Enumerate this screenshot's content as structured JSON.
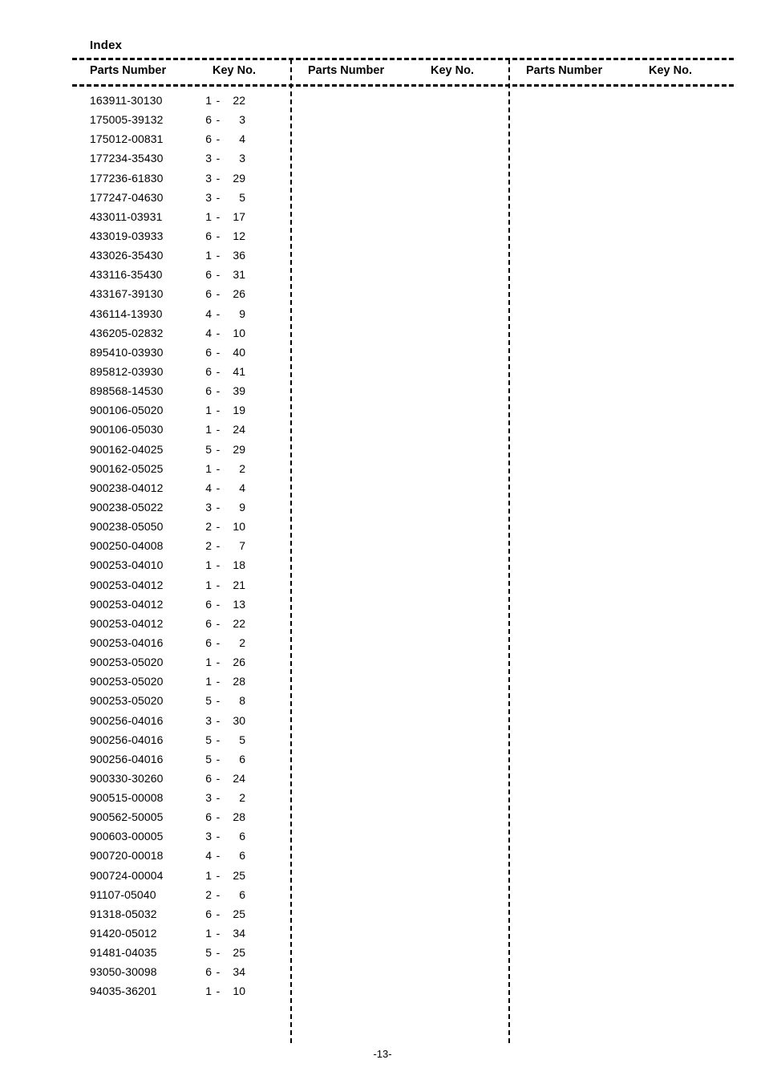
{
  "document": {
    "index_title": "Index",
    "page_number": "-13-"
  },
  "columns": [
    {
      "header_parts_number": "Parts Number",
      "header_key_no": "Key No.",
      "rows": [
        {
          "part": "163911-30130",
          "fig": "1",
          "dash": "-",
          "key": "22"
        },
        {
          "part": "175005-39132",
          "fig": "6",
          "dash": "-",
          "key": "3"
        },
        {
          "part": "175012-00831",
          "fig": "6",
          "dash": "-",
          "key": "4"
        },
        {
          "part": "177234-35430",
          "fig": "3",
          "dash": "-",
          "key": "3"
        },
        {
          "part": "177236-61830",
          "fig": "3",
          "dash": "-",
          "key": "29"
        },
        {
          "part": "177247-04630",
          "fig": "3",
          "dash": "-",
          "key": "5"
        },
        {
          "part": "433011-03931",
          "fig": "1",
          "dash": "-",
          "key": "17"
        },
        {
          "part": "433019-03933",
          "fig": "6",
          "dash": "-",
          "key": "12"
        },
        {
          "part": "433026-35430",
          "fig": "1",
          "dash": "-",
          "key": "36"
        },
        {
          "part": "433116-35430",
          "fig": "6",
          "dash": "-",
          "key": "31"
        },
        {
          "part": "433167-39130",
          "fig": "6",
          "dash": "-",
          "key": "26"
        },
        {
          "part": "436114-13930",
          "fig": "4",
          "dash": "-",
          "key": "9"
        },
        {
          "part": "436205-02832",
          "fig": "4",
          "dash": "-",
          "key": "10"
        },
        {
          "part": "895410-03930",
          "fig": "6",
          "dash": "-",
          "key": "40"
        },
        {
          "part": "895812-03930",
          "fig": "6",
          "dash": "-",
          "key": "41"
        },
        {
          "part": "898568-14530",
          "fig": "6",
          "dash": "-",
          "key": "39"
        },
        {
          "part": "900106-05020",
          "fig": "1",
          "dash": "-",
          "key": "19"
        },
        {
          "part": "900106-05030",
          "fig": "1",
          "dash": "-",
          "key": "24"
        },
        {
          "part": "900162-04025",
          "fig": "5",
          "dash": "-",
          "key": "29"
        },
        {
          "part": "900162-05025",
          "fig": "1",
          "dash": "-",
          "key": "2"
        },
        {
          "part": "900238-04012",
          "fig": "4",
          "dash": "-",
          "key": "4"
        },
        {
          "part": "900238-05022",
          "fig": "3",
          "dash": "-",
          "key": "9"
        },
        {
          "part": "900238-05050",
          "fig": "2",
          "dash": "-",
          "key": "10"
        },
        {
          "part": "900250-04008",
          "fig": "2",
          "dash": "-",
          "key": "7"
        },
        {
          "part": "900253-04010",
          "fig": "1",
          "dash": "-",
          "key": "18"
        },
        {
          "part": "900253-04012",
          "fig": "1",
          "dash": "-",
          "key": "21"
        },
        {
          "part": "900253-04012",
          "fig": "6",
          "dash": "-",
          "key": "13"
        },
        {
          "part": "900253-04012",
          "fig": "6",
          "dash": "-",
          "key": "22"
        },
        {
          "part": "900253-04016",
          "fig": "6",
          "dash": "-",
          "key": "2"
        },
        {
          "part": "900253-05020",
          "fig": "1",
          "dash": "-",
          "key": "26"
        },
        {
          "part": "900253-05020",
          "fig": "1",
          "dash": "-",
          "key": "28"
        },
        {
          "part": "900253-05020",
          "fig": "5",
          "dash": "-",
          "key": "8"
        },
        {
          "part": "900256-04016",
          "fig": "3",
          "dash": "-",
          "key": "30"
        },
        {
          "part": "900256-04016",
          "fig": "5",
          "dash": "-",
          "key": "5"
        },
        {
          "part": "900256-04016",
          "fig": "5",
          "dash": "-",
          "key": "6"
        },
        {
          "part": "900330-30260",
          "fig": "6",
          "dash": "-",
          "key": "24"
        },
        {
          "part": "900515-00008",
          "fig": "3",
          "dash": "-",
          "key": "2"
        },
        {
          "part": "900562-50005",
          "fig": "6",
          "dash": "-",
          "key": "28"
        },
        {
          "part": "900603-00005",
          "fig": "3",
          "dash": "-",
          "key": "6"
        },
        {
          "part": "900720-00018",
          "fig": "4",
          "dash": "-",
          "key": "6"
        },
        {
          "part": "900724-00004",
          "fig": "1",
          "dash": "-",
          "key": "25"
        },
        {
          "part": "91107-05040",
          "fig": "2",
          "dash": "-",
          "key": "6"
        },
        {
          "part": "91318-05032",
          "fig": "6",
          "dash": "-",
          "key": "25"
        },
        {
          "part": "91420-05012",
          "fig": "1",
          "dash": "-",
          "key": "34"
        },
        {
          "part": "91481-04035",
          "fig": "5",
          "dash": "-",
          "key": "25"
        },
        {
          "part": "93050-30098",
          "fig": "6",
          "dash": "-",
          "key": "34"
        },
        {
          "part": "94035-36201",
          "fig": "1",
          "dash": "-",
          "key": "10"
        }
      ]
    },
    {
      "header_parts_number": "Parts Number",
      "header_key_no": "Key No.",
      "rows": []
    },
    {
      "header_parts_number": "Parts Number",
      "header_key_no": "Key No.",
      "rows": []
    }
  ]
}
